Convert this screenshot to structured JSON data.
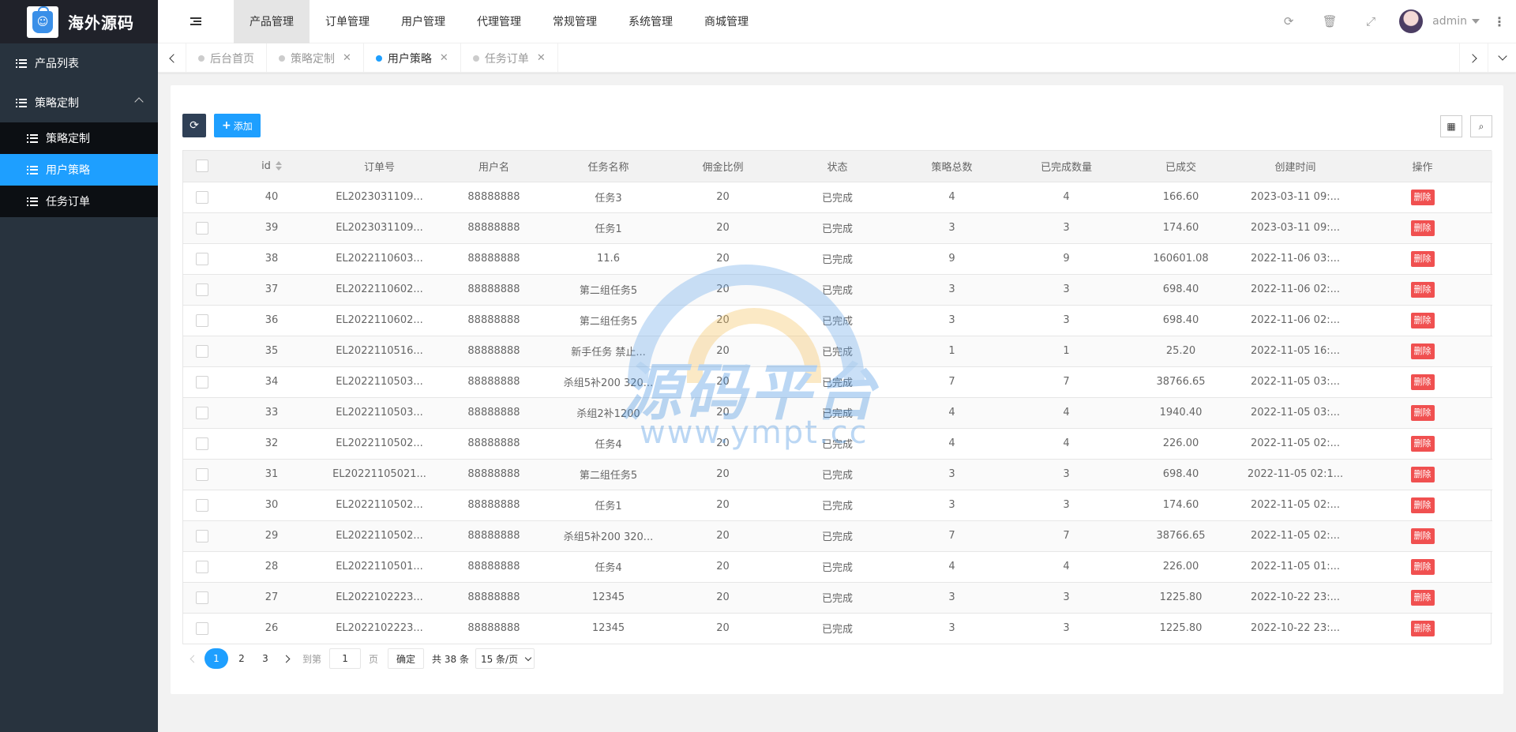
{
  "brand": {
    "name": "海外源码"
  },
  "sidebar": {
    "items": [
      {
        "label": "产品列表"
      },
      {
        "label": "策略定制",
        "expanded": true,
        "children": [
          {
            "label": "策略定制",
            "active": false
          },
          {
            "label": "用户策略",
            "active": true
          },
          {
            "label": "任务订单",
            "active": false
          }
        ]
      }
    ]
  },
  "topnav": {
    "items": [
      {
        "label": "产品管理",
        "active": true
      },
      {
        "label": "订单管理"
      },
      {
        "label": "用户管理"
      },
      {
        "label": "代理管理"
      },
      {
        "label": "常规管理"
      },
      {
        "label": "系统管理"
      },
      {
        "label": "商城管理"
      }
    ]
  },
  "header": {
    "username": "admin"
  },
  "tabs": [
    {
      "label": "后台首页",
      "closable": false,
      "active": false
    },
    {
      "label": "策略定制",
      "closable": true,
      "active": false
    },
    {
      "label": "用户策略",
      "closable": true,
      "active": true
    },
    {
      "label": "任务订单",
      "closable": true,
      "active": false
    }
  ],
  "toolbar": {
    "add_label": "添加"
  },
  "table": {
    "columns": [
      "id",
      "订单号",
      "用户名",
      "任务名称",
      "佣金比例",
      "状态",
      "策略总数",
      "已完成数量",
      "已成交",
      "创建时间",
      "操作"
    ],
    "action_label": "删除",
    "rows": [
      [
        "40",
        "EL2023031109...",
        "88888888",
        "任务3",
        "20",
        "已完成",
        "4",
        "4",
        "166.60",
        "2023-03-11 09:..."
      ],
      [
        "39",
        "EL2023031109...",
        "88888888",
        "任务1",
        "20",
        "已完成",
        "3",
        "3",
        "174.60",
        "2023-03-11 09:..."
      ],
      [
        "38",
        "EL2022110603...",
        "88888888",
        "11.6",
        "20",
        "已完成",
        "9",
        "9",
        "160601.08",
        "2022-11-06 03:..."
      ],
      [
        "37",
        "EL2022110602...",
        "88888888",
        "第二组任务5",
        "20",
        "已完成",
        "3",
        "3",
        "698.40",
        "2022-11-06 02:..."
      ],
      [
        "36",
        "EL2022110602...",
        "88888888",
        "第二组任务5",
        "20",
        "已完成",
        "3",
        "3",
        "698.40",
        "2022-11-06 02:..."
      ],
      [
        "35",
        "EL2022110516...",
        "88888888",
        "新手任务 禁止...",
        "20",
        "已完成",
        "1",
        "1",
        "25.20",
        "2022-11-05 16:..."
      ],
      [
        "34",
        "EL2022110503...",
        "88888888",
        "杀组5补200 320...",
        "20",
        "已完成",
        "7",
        "7",
        "38766.65",
        "2022-11-05 03:..."
      ],
      [
        "33",
        "EL2022110503...",
        "88888888",
        "杀组2补1200",
        "20",
        "已完成",
        "4",
        "4",
        "1940.40",
        "2022-11-05 03:..."
      ],
      [
        "32",
        "EL2022110502...",
        "88888888",
        "任务4",
        "20",
        "已完成",
        "4",
        "4",
        "226.00",
        "2022-11-05 02:..."
      ],
      [
        "31",
        "EL20221105021...",
        "88888888",
        "第二组任务5",
        "20",
        "已完成",
        "3",
        "3",
        "698.40",
        "2022-11-05 02:1..."
      ],
      [
        "30",
        "EL2022110502...",
        "88888888",
        "任务1",
        "20",
        "已完成",
        "3",
        "3",
        "174.60",
        "2022-11-05 02:..."
      ],
      [
        "29",
        "EL2022110502...",
        "88888888",
        "杀组5补200 320...",
        "20",
        "已完成",
        "7",
        "7",
        "38766.65",
        "2022-11-05 02:..."
      ],
      [
        "28",
        "EL2022110501...",
        "88888888",
        "任务4",
        "20",
        "已完成",
        "4",
        "4",
        "226.00",
        "2022-11-05 01:..."
      ],
      [
        "27",
        "EL2022102223...",
        "88888888",
        "12345",
        "20",
        "已完成",
        "3",
        "3",
        "1225.80",
        "2022-10-22 23:..."
      ],
      [
        "26",
        "EL2022102223...",
        "88888888",
        "12345",
        "20",
        "已完成",
        "3",
        "3",
        "1225.80",
        "2022-10-22 23:..."
      ]
    ]
  },
  "pager": {
    "pages": [
      "1",
      "2",
      "3"
    ],
    "current": "1",
    "goto_label": "到第",
    "goto_value": "1",
    "page_unit": "页",
    "confirm_label": "确定",
    "total_label": "共 38 条",
    "page_size": "15 条/页"
  },
  "watermark": {
    "title": "源码平台",
    "url": "www.ympt.cc"
  },
  "colors": {
    "accent": "#1e9fff",
    "sidebar": "#28333e",
    "danger": "#f05050"
  }
}
